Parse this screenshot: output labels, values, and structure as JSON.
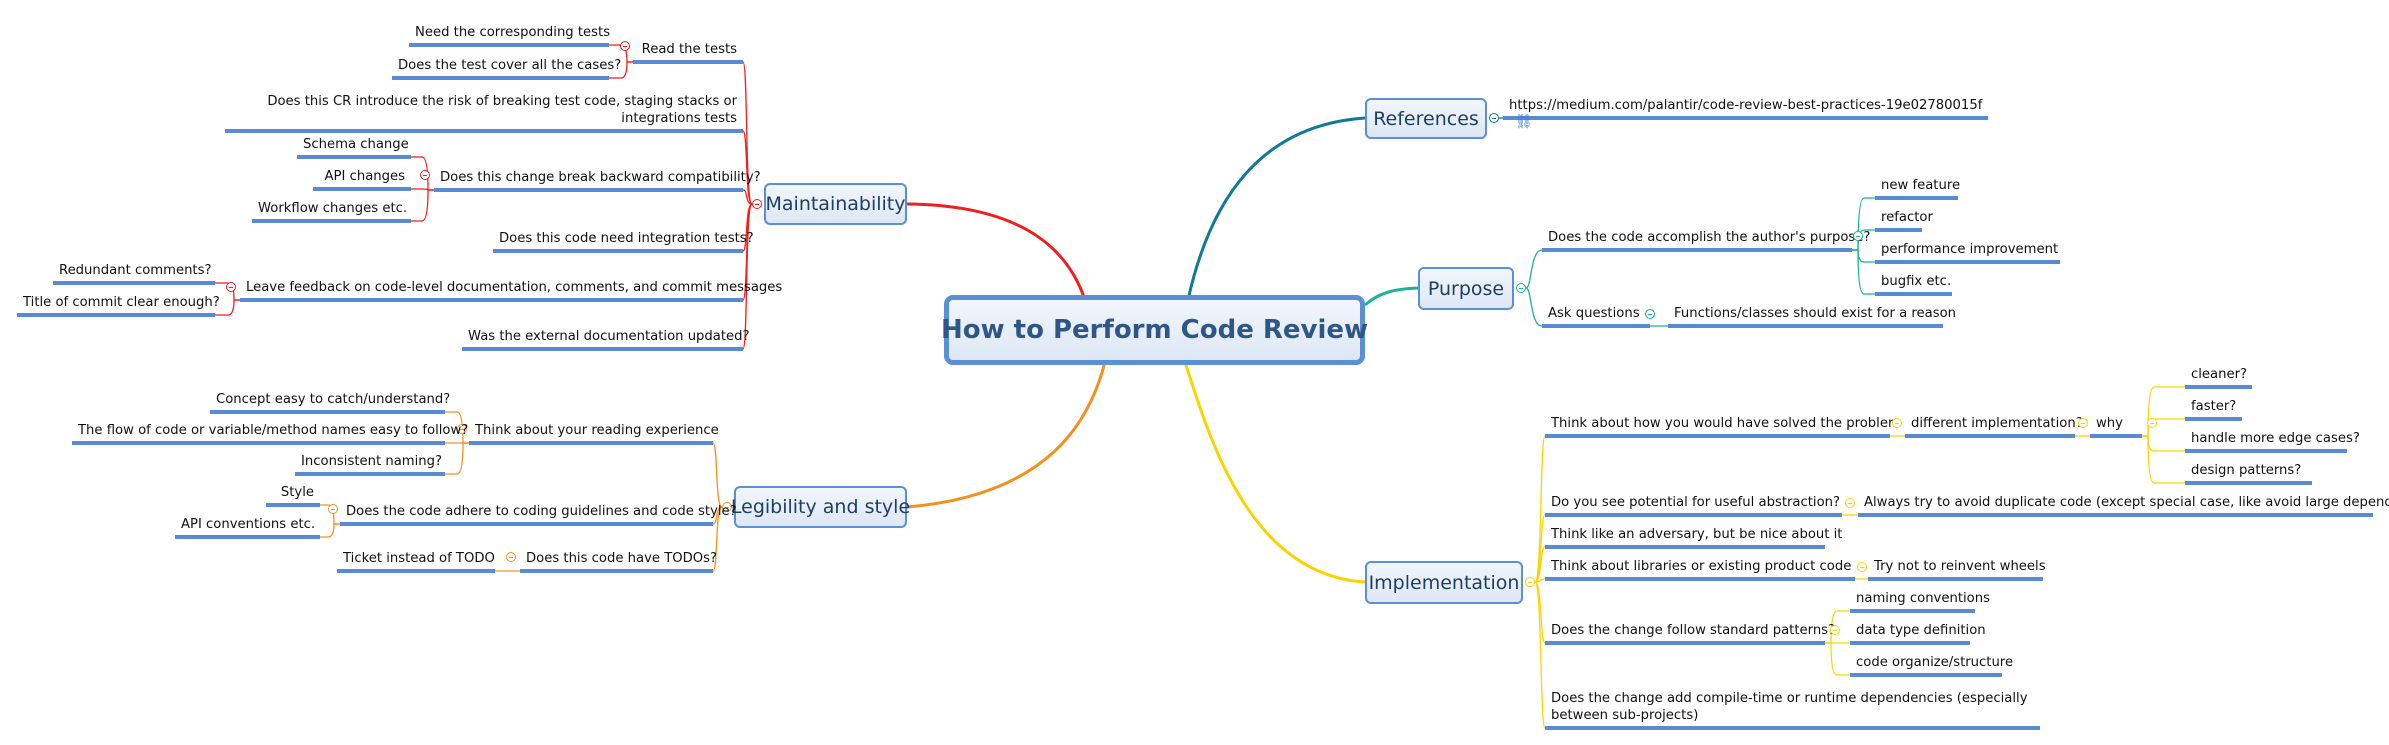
{
  "central": {
    "title": "How to Perform Code Review"
  },
  "colors": {
    "maintainability": "#f01e1e",
    "legibility": "#f5901e",
    "references": "#0f7a94",
    "purpose": "#1ab496",
    "implementation": "#f8d500",
    "underline": "#5a8ad4"
  },
  "branches": {
    "maintainability": {
      "label": "Maintainability",
      "children": [
        {
          "label": "Read the tests",
          "children": [
            {
              "label": "Need the corresponding tests"
            },
            {
              "label": "Does the test cover all the cases?"
            }
          ]
        },
        {
          "label": "Does this CR introduce the risk of breaking test code, staging stacks or integrations tests"
        },
        {
          "label": "Does this change break backward compatibility?",
          "children": [
            {
              "label": "Schema change"
            },
            {
              "label": "API changes"
            },
            {
              "label": "Workflow changes etc."
            }
          ]
        },
        {
          "label": "Does this code need integration tests?"
        },
        {
          "label": "Leave feedback on code-level documentation, comments, and commit messages",
          "children": [
            {
              "label": "Redundant comments?"
            },
            {
              "label": "Title of commit clear enough?"
            }
          ]
        },
        {
          "label": "Was  the external documentation updated?"
        }
      ]
    },
    "legibility": {
      "label": "Legibility and style",
      "children": [
        {
          "label": "Think about your reading experience",
          "children": [
            {
              "label": "Concept easy to catch/understand?"
            },
            {
              "label": "The flow of code or variable/method names easy to follow?"
            },
            {
              "label": "Inconsistent naming?"
            }
          ]
        },
        {
          "label": "Does the code adhere to coding guidelines and code style?",
          "children": [
            {
              "label": "Style"
            },
            {
              "label": "API conventions etc."
            }
          ]
        },
        {
          "label": "Does this code have TODOs?",
          "children": [
            {
              "label": "Ticket instead of TODO"
            }
          ]
        }
      ]
    },
    "references": {
      "label": "References",
      "children": [
        {
          "label": "https://medium.com/palantir/code-review-best-practices-19e02780015f",
          "icon": "link-icon"
        }
      ]
    },
    "purpose": {
      "label": "Purpose",
      "children": [
        {
          "label": "Does the code accomplish the author's purpose?",
          "children": [
            {
              "label": "new feature"
            },
            {
              "label": "refactor"
            },
            {
              "label": "performance improvement"
            },
            {
              "label": "bugfix etc."
            }
          ]
        },
        {
          "label": "Ask questions",
          "children": [
            {
              "label": "Functions/classes should exist for a reason"
            }
          ]
        }
      ]
    },
    "implementation": {
      "label": "Implementation",
      "children": [
        {
          "label": "Think about how you would have solved the problem",
          "children": [
            {
              "label": "different implementation?",
              "children": [
                {
                  "label": "why",
                  "children": [
                    {
                      "label": "cleaner?"
                    },
                    {
                      "label": "faster?"
                    },
                    {
                      "label": "handle more edge cases?"
                    },
                    {
                      "label": "design patterns?"
                    }
                  ]
                }
              ]
            }
          ]
        },
        {
          "label": "Do you see potential for useful abstraction?",
          "children": [
            {
              "label": "Always try to avoid duplicate code (except special case, like avoid large dependency)"
            }
          ]
        },
        {
          "label": "Think like an adversary, but be nice about it"
        },
        {
          "label": "Think about libraries or existing product code",
          "children": [
            {
              "label": "Try not to reinvent wheels"
            }
          ]
        },
        {
          "label": "Does the change follow standard patterns?",
          "children": [
            {
              "label": "naming conventions"
            },
            {
              "label": "data type definition"
            },
            {
              "label": "code organize/structure"
            }
          ]
        },
        {
          "label": "Does the change add compile-time or runtime dependencies (especially between sub-projects)"
        }
      ]
    }
  }
}
